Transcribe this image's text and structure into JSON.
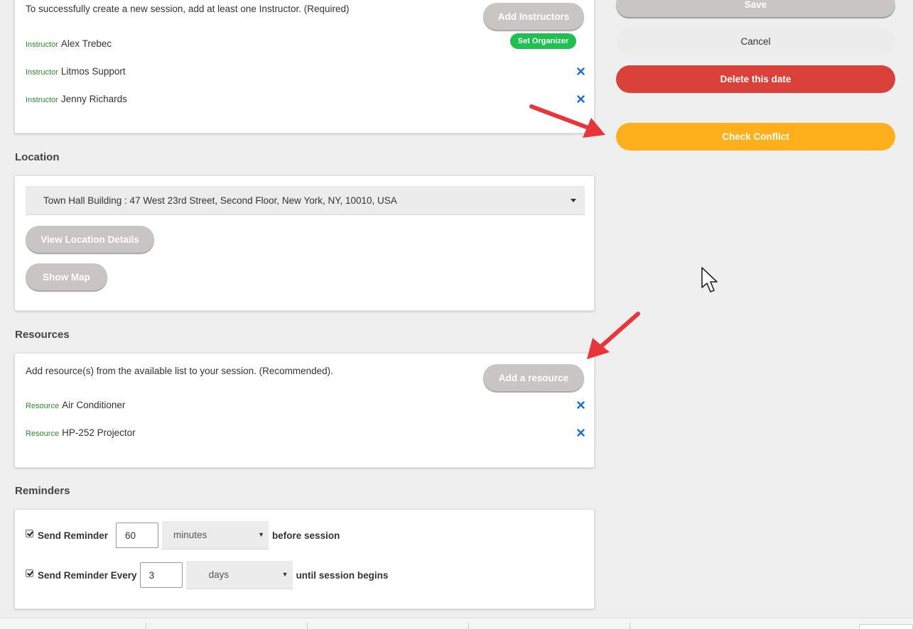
{
  "instructors": {
    "help": "To successfully create a new session, add at least one Instructor. (Required)",
    "add_button": "Add Instructors",
    "tag": "Instructor",
    "items": [
      {
        "name": "Alex Trebec"
      },
      {
        "name": "Litmos Support"
      },
      {
        "name": "Jenny Richards"
      }
    ],
    "set_organizer": "Set Organizer"
  },
  "location": {
    "title": "Location",
    "selected": "Town Hall Building : 47 West 23rd Street, Second Floor, New York, NY, 10010, USA",
    "view_details": "View Location Details",
    "show_map": "Show Map"
  },
  "resources": {
    "title": "Resources",
    "help": "Add resource(s) from the available list to your session. (Recommended).",
    "add_button": "Add a resource",
    "tag": "Resource",
    "items": [
      {
        "name": "Air Conditioner"
      },
      {
        "name": "HP-252 Projector"
      }
    ]
  },
  "reminders": {
    "title": "Reminders",
    "row1": {
      "label": "Send Reminder",
      "value": "60",
      "unit": "minutes",
      "suffix": "before session"
    },
    "row2": {
      "label": "Send Reminder Every",
      "value": "3",
      "unit": "days",
      "suffix": "until session begins"
    }
  },
  "actions": {
    "save": "Save",
    "cancel": "Cancel",
    "delete": "Delete this date",
    "check_conflict": "Check Conflict"
  },
  "colors": {
    "accent_red": "#d9413a",
    "accent_orange": "#fdb01b",
    "green": "#1ec04f",
    "x_blue": "#1a6fd1",
    "annotation_arrow": "#e8353a"
  }
}
